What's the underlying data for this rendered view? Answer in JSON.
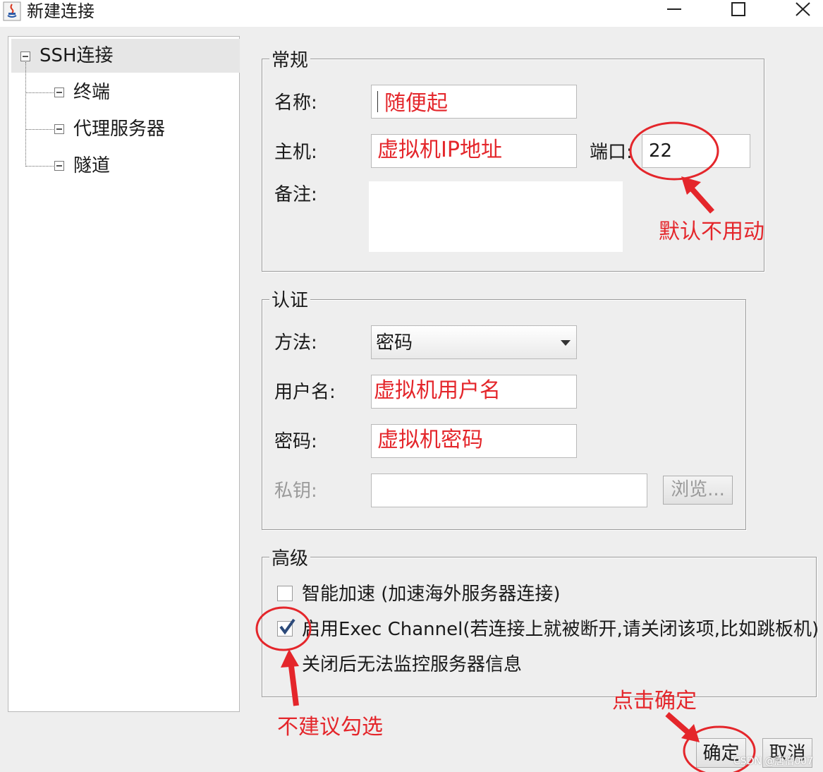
{
  "window": {
    "title": "新建连接"
  },
  "tree": {
    "root": "SSH连接",
    "children": [
      "终端",
      "代理服务器",
      "隧道"
    ]
  },
  "general": {
    "legend": "常规",
    "name_label": "名称:",
    "name_value": "随便起",
    "host_label": "主机:",
    "host_value": "虚拟机IP地址",
    "port_label": "端口:",
    "port_value": "22",
    "note_label": "备注:",
    "note_value": ""
  },
  "auth": {
    "legend": "认证",
    "method_label": "方法:",
    "method_value": "密码",
    "user_label": "用户名:",
    "user_value": "虚拟机用户名",
    "password_label": "密码:",
    "password_value": "虚拟机密码",
    "key_label": "私钥:",
    "key_value": "",
    "browse_label": "浏览..."
  },
  "advanced": {
    "legend": "高级",
    "accel_label": "智能加速 (加速海外服务器连接)",
    "accel_checked": false,
    "exec_label": "启用Exec Channel(若连接上就被断开,请关闭该项,比如跳板机)",
    "exec_note": "关闭后无法监控服务器信息",
    "exec_checked": true
  },
  "footer": {
    "ok_label": "确定",
    "cancel_label": "取消"
  },
  "annotations": {
    "port_note": "默认不用动",
    "exec_note": "不建议勾选",
    "ok_note": "点击确定",
    "watermark": "CSDN @唐僧007",
    "color": "#e4262b"
  }
}
